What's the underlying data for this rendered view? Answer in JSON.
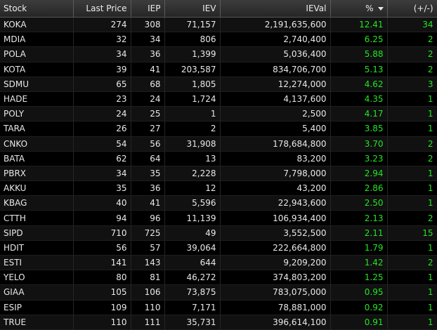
{
  "headers": {
    "stock": "Stock",
    "last_price": "Last Price",
    "iep": "IEP",
    "iev": "IEV",
    "ieval": "IEVal",
    "pct": "%",
    "chg": "(+/-)"
  },
  "sort": {
    "column": "pct",
    "direction": "desc",
    "icon": "sort-desc-icon"
  },
  "colors": {
    "gain": "#22e622",
    "text": "#e8e8e8",
    "background": "#000000"
  },
  "rows": [
    {
      "stock": "KOKA",
      "last": "274",
      "iep": "308",
      "iev": "71,157",
      "ieval": "2,191,635,600",
      "pct": "12.41",
      "chg": "34"
    },
    {
      "stock": "MDIA",
      "last": "32",
      "iep": "34",
      "iev": "806",
      "ieval": "2,740,400",
      "pct": "6.25",
      "chg": "2"
    },
    {
      "stock": "POLA",
      "last": "34",
      "iep": "36",
      "iev": "1,399",
      "ieval": "5,036,400",
      "pct": "5.88",
      "chg": "2"
    },
    {
      "stock": "KOTA",
      "last": "39",
      "iep": "41",
      "iev": "203,587",
      "ieval": "834,706,700",
      "pct": "5.13",
      "chg": "2"
    },
    {
      "stock": "SDMU",
      "last": "65",
      "iep": "68",
      "iev": "1,805",
      "ieval": "12,274,000",
      "pct": "4.62",
      "chg": "3"
    },
    {
      "stock": "HADE",
      "last": "23",
      "iep": "24",
      "iev": "1,724",
      "ieval": "4,137,600",
      "pct": "4.35",
      "chg": "1"
    },
    {
      "stock": "POLY",
      "last": "24",
      "iep": "25",
      "iev": "1",
      "ieval": "2,500",
      "pct": "4.17",
      "chg": "1"
    },
    {
      "stock": "TARA",
      "last": "26",
      "iep": "27",
      "iev": "2",
      "ieval": "5,400",
      "pct": "3.85",
      "chg": "1"
    },
    {
      "stock": "CNKO",
      "last": "54",
      "iep": "56",
      "iev": "31,908",
      "ieval": "178,684,800",
      "pct": "3.70",
      "chg": "2"
    },
    {
      "stock": "BATA",
      "last": "62",
      "iep": "64",
      "iev": "13",
      "ieval": "83,200",
      "pct": "3.23",
      "chg": "2"
    },
    {
      "stock": "PBRX",
      "last": "34",
      "iep": "35",
      "iev": "2,228",
      "ieval": "7,798,000",
      "pct": "2.94",
      "chg": "1"
    },
    {
      "stock": "AKKU",
      "last": "35",
      "iep": "36",
      "iev": "12",
      "ieval": "43,200",
      "pct": "2.86",
      "chg": "1"
    },
    {
      "stock": "KBAG",
      "last": "40",
      "iep": "41",
      "iev": "5,596",
      "ieval": "22,943,600",
      "pct": "2.50",
      "chg": "1"
    },
    {
      "stock": "CTTH",
      "last": "94",
      "iep": "96",
      "iev": "11,139",
      "ieval": "106,934,400",
      "pct": "2.13",
      "chg": "2"
    },
    {
      "stock": "SIPD",
      "last": "710",
      "iep": "725",
      "iev": "49",
      "ieval": "3,552,500",
      "pct": "2.11",
      "chg": "15"
    },
    {
      "stock": "HDIT",
      "last": "56",
      "iep": "57",
      "iev": "39,064",
      "ieval": "222,664,800",
      "pct": "1.79",
      "chg": "1"
    },
    {
      "stock": "ESTI",
      "last": "141",
      "iep": "143",
      "iev": "644",
      "ieval": "9,209,200",
      "pct": "1.42",
      "chg": "2"
    },
    {
      "stock": "YELO",
      "last": "80",
      "iep": "81",
      "iev": "46,272",
      "ieval": "374,803,200",
      "pct": "1.25",
      "chg": "1"
    },
    {
      "stock": "GIAA",
      "last": "105",
      "iep": "106",
      "iev": "73,875",
      "ieval": "783,075,000",
      "pct": "0.95",
      "chg": "1"
    },
    {
      "stock": "ESIP",
      "last": "109",
      "iep": "110",
      "iev": "7,171",
      "ieval": "78,881,000",
      "pct": "0.92",
      "chg": "1"
    },
    {
      "stock": "TRUE",
      "last": "110",
      "iep": "111",
      "iev": "35,731",
      "ieval": "396,614,100",
      "pct": "0.91",
      "chg": "1"
    }
  ]
}
